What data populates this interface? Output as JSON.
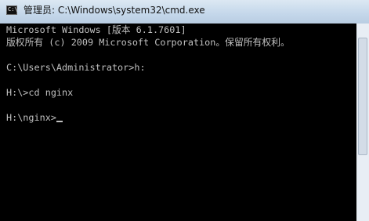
{
  "window": {
    "title": "管理员: C:\\Windows\\system32\\cmd.exe",
    "icon": "console-icon",
    "icon_glyph": "C:\\"
  },
  "console": {
    "lines": [
      "Microsoft Windows [版本 6.1.7601]",
      "版权所有 (c) 2009 Microsoft Corporation。保留所有权利。",
      "",
      "C:\\Users\\Administrator>h:",
      "",
      "H:\\>cd nginx",
      "",
      "H:\\nginx>"
    ],
    "text_color": "#c0c0c0",
    "background_color": "#000000"
  }
}
